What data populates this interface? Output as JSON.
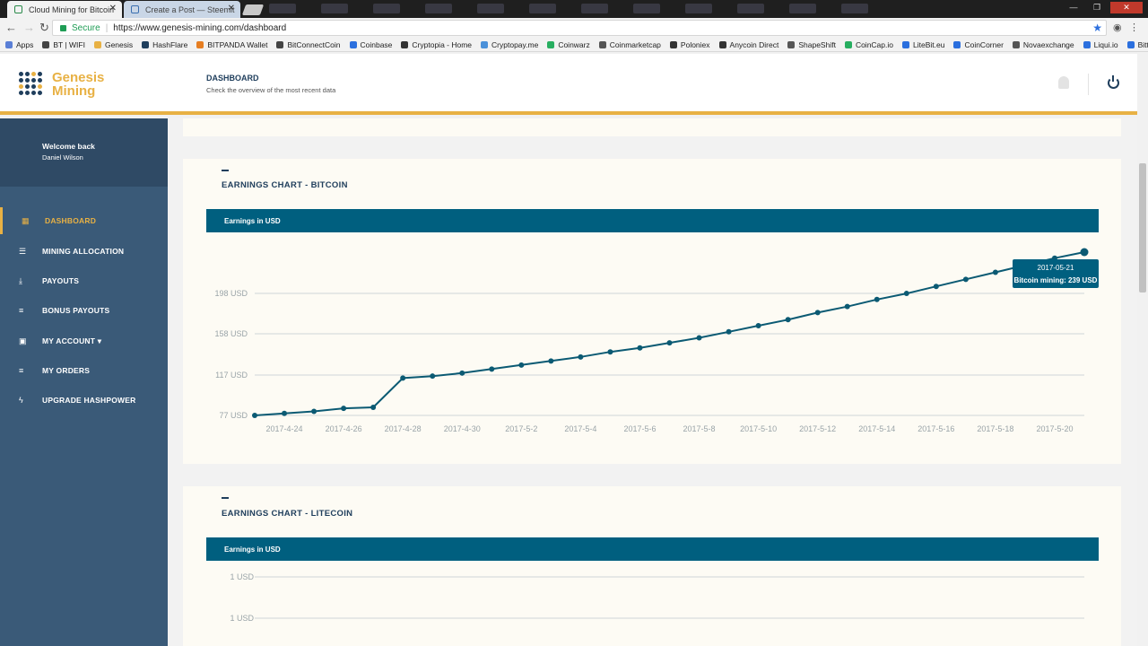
{
  "browser": {
    "tabs": [
      {
        "title": "Cloud Mining for Bitcoin"
      },
      {
        "title": "Create a Post — Steemit"
      }
    ],
    "secure_label": "Secure",
    "url": "https://www.genesis-mining.com/dashboard",
    "bookmarks": [
      "Apps",
      "BT | WIFI",
      "Genesis",
      "HashFlare",
      "BITPANDA Wallet",
      "BitConnectCoin",
      "Coinbase",
      "Cryptopia - Home",
      "Cryptopay.me",
      "Coinwarz",
      "Coinmarketcap",
      "Poloniex",
      "Anycoin Direct",
      "ShapeShift",
      "CoinCap.io",
      "LiteBit.eu",
      "CoinCorner",
      "Novaexchange",
      "Liqui.io",
      "Bittrex"
    ]
  },
  "header": {
    "logo_line1": "Genesis",
    "logo_line2": "Mining",
    "title": "DASHBOARD",
    "subtitle": "Check the overview of the most recent data"
  },
  "sidebar": {
    "welcome": "Welcome back",
    "user": "Daniel Wilson",
    "items": [
      {
        "label": "DASHBOARD",
        "icon": "grid-icon"
      },
      {
        "label": "MINING ALLOCATION",
        "icon": "sliders-icon"
      },
      {
        "label": "PAYOUTS",
        "icon": "download-icon"
      },
      {
        "label": "BONUS PAYOUTS",
        "icon": "list-icon"
      },
      {
        "label": "MY ACCOUNT ▾",
        "icon": "account-icon"
      },
      {
        "label": "MY ORDERS",
        "icon": "list-icon"
      },
      {
        "label": "UPGRADE HASHPOWER",
        "icon": "lightning-icon"
      }
    ]
  },
  "bitcoin_card": {
    "title": "EARNINGS CHART - BITCOIN",
    "bar_label": "Earnings in USD"
  },
  "litecoin_card": {
    "title": "EARNINGS CHART - LITECOIN",
    "bar_label": "Earnings in USD"
  },
  "chart_data": [
    {
      "type": "line",
      "title": "EARNINGS CHART - BITCOIN",
      "ylabel": "Earnings in USD",
      "y_ticks": [
        "77 USD",
        "117 USD",
        "158 USD",
        "198 USD"
      ],
      "y_tick_values": [
        77,
        117,
        158,
        198
      ],
      "x_ticks": [
        "2017-4-24",
        "2017-4-26",
        "2017-4-28",
        "2017-4-30",
        "2017-5-2",
        "2017-5-4",
        "2017-5-6",
        "2017-5-8",
        "2017-5-10",
        "2017-5-12",
        "2017-5-14",
        "2017-5-16",
        "2017-5-18",
        "2017-5-20"
      ],
      "ylim": [
        77,
        239
      ],
      "x": [
        "2017-04-23",
        "2017-04-24",
        "2017-04-25",
        "2017-04-26",
        "2017-04-27",
        "2017-04-28",
        "2017-04-29",
        "2017-04-30",
        "2017-05-01",
        "2017-05-02",
        "2017-05-03",
        "2017-05-04",
        "2017-05-05",
        "2017-05-06",
        "2017-05-07",
        "2017-05-08",
        "2017-05-09",
        "2017-05-10",
        "2017-05-11",
        "2017-05-12",
        "2017-05-13",
        "2017-05-14",
        "2017-05-15",
        "2017-05-16",
        "2017-05-17",
        "2017-05-18",
        "2017-05-19",
        "2017-05-20",
        "2017-05-21"
      ],
      "values": [
        77,
        79,
        81,
        84,
        85,
        114,
        116,
        119,
        123,
        127,
        131,
        135,
        140,
        144,
        149,
        154,
        160,
        166,
        172,
        179,
        185,
        192,
        198,
        205,
        212,
        219,
        226,
        233,
        239
      ],
      "tooltip": {
        "date": "2017-05-21",
        "text": "Bitcoin mining: 239 USD"
      }
    },
    {
      "type": "line",
      "title": "EARNINGS CHART - LITECOIN",
      "ylabel": "Earnings in USD",
      "y_ticks": [
        "1 USD",
        "1 USD"
      ]
    }
  ]
}
